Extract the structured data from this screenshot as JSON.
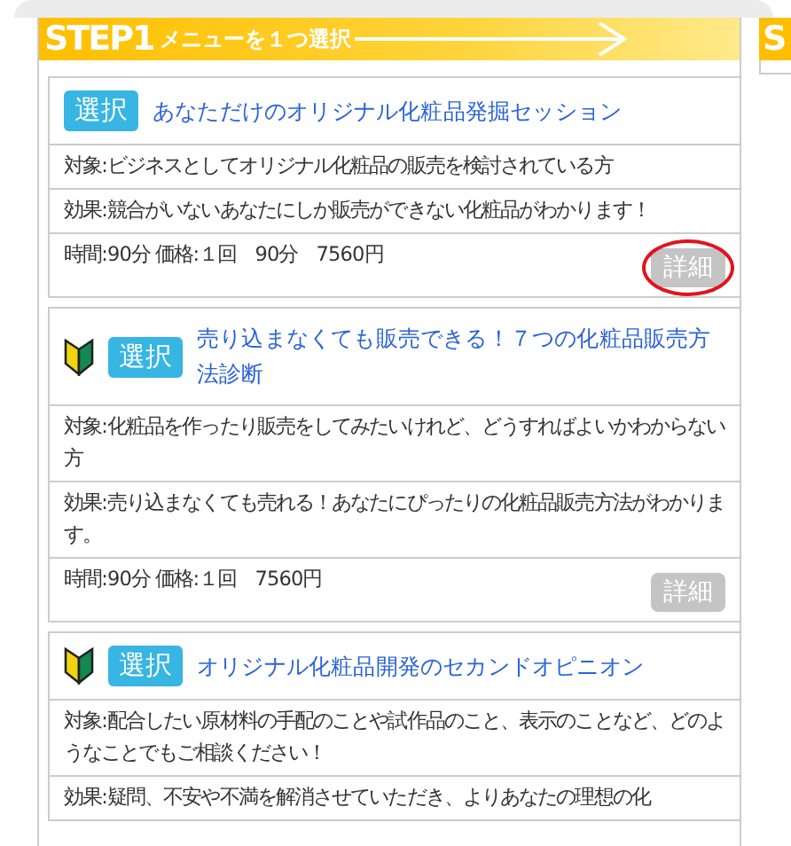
{
  "step": {
    "label": "STEP1",
    "caption": "メニューを１つ選択",
    "next_label": "S"
  },
  "menus": [
    {
      "beginner": false,
      "select_label": "選択",
      "title": "あなただけのオリジナル化粧品発掘セッション",
      "target": "対象:ビジネスとしてオリジナル化粧品の販売を検討されている方",
      "effect": "効果:競合がいないあなたにしか販売ができない化粧品がわかります！",
      "price": "時間:90分 価格:１回　90分　7560円",
      "detail_label": "詳細",
      "circled": true
    },
    {
      "beginner": true,
      "select_label": "選択",
      "title": "売り込まなくても販売できる！７つの化粧品販売方法診断",
      "target": "対象:化粧品を作ったり販売をしてみたいけれど、どうすればよいかわからない方",
      "effect": "効果:売り込まなくても売れる！あなたにぴったりの化粧品販売方法がわかります。",
      "price": "時間:90分 価格:１回　7560円",
      "detail_label": "詳細",
      "circled": false
    },
    {
      "beginner": true,
      "select_label": "選択",
      "title": "オリジナル化粧品開発のセカンドオピニオン",
      "target": "対象:配合したい原材料の手配のことや試作品のこと、表示のことなど、どのようなことでもご相談ください！",
      "effect": "効果:疑問、不安や不満を解消させていただき、よりあなたの理想の化"
    }
  ]
}
